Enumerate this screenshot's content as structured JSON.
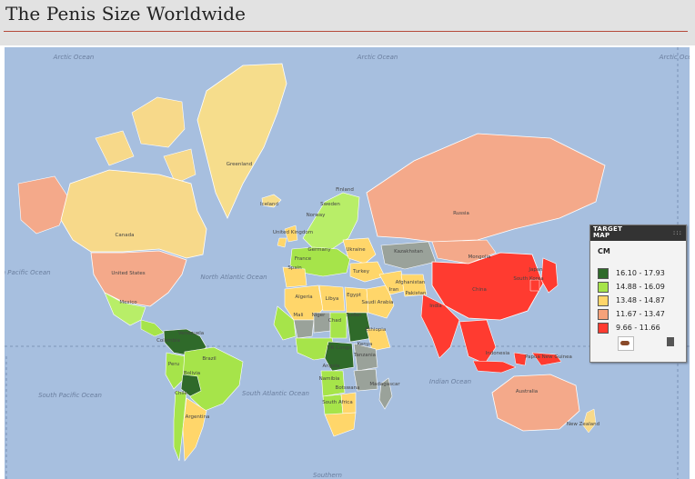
{
  "page": {
    "title": "The Penis Size Worldwide"
  },
  "map": {
    "ocean_labels": {
      "arctic_left": "Arctic Ocean",
      "arctic_mid": "Arctic Ocean",
      "arctic_right": "Arctic Ocean",
      "north_pacific": "North Pacific Ocean",
      "north_atlantic": "North Atlantic Ocean",
      "south_pacific": "South Pacific Ocean",
      "south_atlantic": "South Atlantic Ocean",
      "indian": "Indian Ocean",
      "southern": "Southern"
    },
    "countries": {
      "greenland": "Greenland",
      "iceland": "Iceland",
      "canada": "Canada",
      "united_states": "United States",
      "mexico": "Mexico",
      "colombia": "Colombia",
      "venezuela": "Venezuela",
      "peru": "Peru",
      "brazil": "Brazil",
      "bolivia": "Bolivia",
      "chile": "Chile",
      "argentina": "Argentina",
      "united_kingdom": "United Kingdom",
      "norway": "Norway",
      "finland": "Finland",
      "sweden": "Sweden",
      "germany": "Germany",
      "france": "France",
      "spain": "Spain",
      "ukraine": "Ukraine",
      "turkey": "Turkey",
      "algeria": "Algeria",
      "libya": "Libya",
      "egypt": "Egypt",
      "mali": "Mali",
      "niger": "Niger",
      "chad": "Chad",
      "sudan": "Sudan",
      "ethiopia": "Ethiopia",
      "dr_congo": "DR Congo",
      "kenya": "Kenya",
      "tanzania": "Tanzania",
      "angola": "Angola",
      "namibia": "Namibia",
      "botswana": "Botswana",
      "south_africa": "South Africa",
      "madagascar": "Madagascar",
      "saudi_arabia": "Saudi Arabia",
      "iran": "Iran",
      "afghanistan": "Afghanistan",
      "pakistan": "Pakistan",
      "kazakhstan": "Kazakhstan",
      "russia": "Russia",
      "mongolia": "Mongolia",
      "china": "China",
      "india": "India",
      "japan": "Japan",
      "south_korea": "South Korea",
      "indonesia": "Indonesia",
      "papua_new_guinea": "Papua New Guinea",
      "australia": "Australia",
      "new_zealand": "New Zealand"
    },
    "colors": {
      "ocean": "#a7bfdf",
      "class_1": "#2f6a2a",
      "class_2": "#a6e44a",
      "class_3": "#ffd66a",
      "class_4": "#f5a27a",
      "class_5": "#ff3b30",
      "no_data": "#9aa29a",
      "greenland": "#f6dd8c"
    }
  },
  "legend": {
    "brand": "TARGET MAP",
    "brand_line1": "TARGET",
    "brand_line2": "MAP",
    "unit": "CM",
    "items": [
      {
        "range": "16.10 - 17.93",
        "color": "#2f6a2a"
      },
      {
        "range": "14.88 - 16.09",
        "color": "#a6e44a"
      },
      {
        "range": "13.48 - 14.87",
        "color": "#ffd66a"
      },
      {
        "range": "11.67 - 13.47",
        "color": "#f5a27a"
      },
      {
        "range": "9.66 - 11.66",
        "color": "#ff3b30"
      }
    ]
  }
}
